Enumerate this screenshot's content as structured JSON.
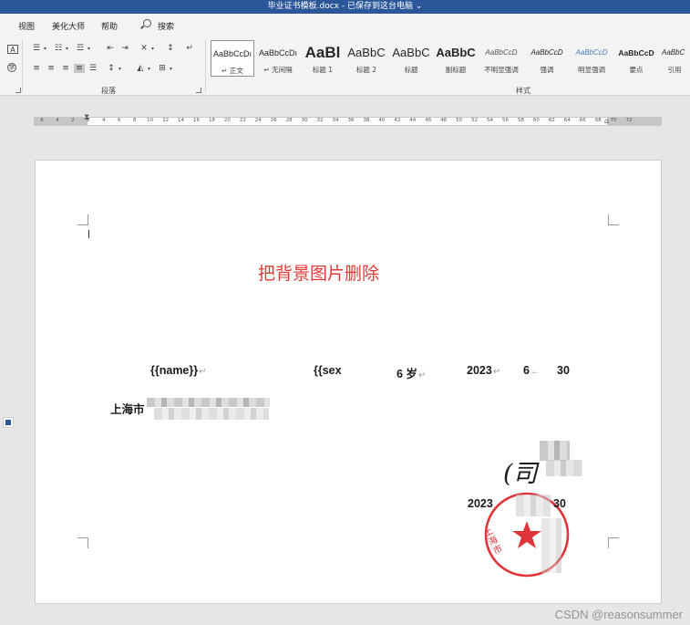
{
  "window": {
    "title": "毕业证书模板.docx  -  已保存到这台电脑  ⌄"
  },
  "menu": {
    "items": [
      "视图",
      "美化大师",
      "帮助"
    ],
    "search_label": "搜索"
  },
  "ribbon": {
    "paragraph_group_label": "段落",
    "styles_group_label": "样式",
    "styles": [
      {
        "preview": "AaBbCcDı",
        "name": "↵ 正文"
      },
      {
        "preview": "AaBbCcDı",
        "name": "↵ 无间隔"
      },
      {
        "preview": "AaBl",
        "name": "标题 1"
      },
      {
        "preview": "AaBbC",
        "name": "标题 2"
      },
      {
        "preview": "AaBbC",
        "name": "标题"
      },
      {
        "preview": "AaBbC",
        "name": "副标题"
      },
      {
        "preview": "AaBbCcD",
        "name": "不明显强调"
      },
      {
        "preview": "AaBbCcD",
        "name": "强调"
      },
      {
        "preview": "AaBbCcD",
        "name": "明显强调"
      },
      {
        "preview": "AaBbCcD",
        "name": "要点"
      },
      {
        "preview": "AaBbC",
        "name": "引用"
      }
    ]
  },
  "ruler": {
    "ticks": [
      "6",
      "4",
      "2",
      "2",
      "4",
      "6",
      "8",
      "10",
      "12",
      "14",
      "16",
      "18",
      "20",
      "22",
      "24",
      "26",
      "28",
      "30",
      "32",
      "34",
      "36",
      "38",
      "40",
      "42",
      "44",
      "46",
      "48",
      "50",
      "52",
      "54",
      "56",
      "58",
      "60",
      "62",
      "64",
      "66",
      "68",
      "70",
      "72"
    ]
  },
  "document": {
    "title": "把背景图片删除",
    "name_field": "{{name}}",
    "sex_field": "{{sex",
    "age": "6 岁",
    "year": "2023",
    "month": "6",
    "day": "30",
    "city": "上海市",
    "sign_year": "2023",
    "sign_day": "30",
    "seal_text": "上海市",
    "signature": "(司"
  },
  "watermark": "CSDN @reasonsummer",
  "colors": {
    "title_bar": "#2b579a",
    "title_red": "#e53935",
    "seal_red": "#e0343a"
  }
}
